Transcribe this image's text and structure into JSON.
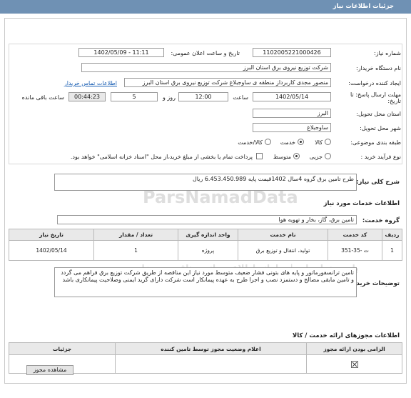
{
  "header": {
    "title": "جزئیات اطلاعات نیاز"
  },
  "form": {
    "need_number_label": "شماره نیاز:",
    "need_number": "1102005221000426",
    "announce_label": "تاریخ و ساعت اعلان عمومی:",
    "announce_value": "1402/05/09 - 11:11",
    "buyer_label": "نام دستگاه خریدار:",
    "buyer_value": "شرکت توزیع نیروی برق استان البرز",
    "creator_label": "ایجاد کننده درخواست:",
    "creator_value": "منصور مجدی کاربرداز منطقه ی ساوجبلاغ شرکت توزیع نیروی برق استان البرز",
    "contact_link": "اطلاعات تماس خریدار",
    "deadline_label": "مهلت ارسال پاسخ: تا تاریخ:",
    "deadline_date": "1402/05/14",
    "hour_label": "ساعت",
    "deadline_hour": "12:00",
    "days_value": "5",
    "days_label": "روز و",
    "remaining_time": "00:44:23",
    "remaining_label": "ساعت باقی مانده",
    "province_label": "استان محل تحویل:",
    "province_value": "البرز",
    "city_label": "شهر محل تحویل:",
    "city_value": "ساوجبلاغ",
    "category_label": "طبقه بندی موضوعی:",
    "category_options": [
      "کالا",
      "خدمت",
      "کالا/خدمت"
    ],
    "category_selected": "خدمت",
    "process_label": "نوع فرآیند خرید :",
    "process_options": [
      "جزیی",
      "متوسط"
    ],
    "process_selected": "متوسط",
    "payment_note": "پرداخت تمام یا بخشی از مبلغ خرید،از محل \"اسناد خزانه اسلامی\" خواهد بود."
  },
  "description": {
    "label": "شرح کلی نیاز:",
    "value": "طرح تامین برق گروه 4سال 1402قیمت پایه 6.453.450.989 ریال"
  },
  "services": {
    "section_title": "اطلاعات خدمات مورد نیاز",
    "group_label": "گروه خدمت:",
    "group_value": "تامین برق، گاز، بخار و تهویه هوا",
    "columns": [
      "ردیف",
      "کد خدمت",
      "نام خدمت",
      "واحد اندازه گیری",
      "تعداد / مقدار",
      "تاریخ نیاز"
    ],
    "rows": [
      {
        "index": "1",
        "code": "ت -35-351",
        "name": "تولید، انتقال و توزیع برق",
        "unit": "پروژه",
        "qty": "1",
        "date": "1402/05/14"
      }
    ]
  },
  "buyer_notes": {
    "label": "توضیحات خریدار:",
    "value": "تامین ترانسفورماتور و پایه های بتونی فشار ضعیف متوسط مورد نیاز این مناقصه از طریق شرکت توزیع برق فراهم می گردد و تامین مابقی مصالح و دستمزد نصب و اجرا طرح به عهده پیمانکار است شرکت دارای گرید ایمنی وصلاحیت پیمانکاری باشد"
  },
  "supplier_docs": {
    "section_title": "اطلاعات مجوزهای ارائه خدمت / کالا",
    "columns": [
      "الزامی بودن ارائه مجوز",
      "اعلام وضعیت مجوز توسط تامین کننده",
      "جزئیات"
    ],
    "view_button": "مشاهده مجوز"
  },
  "watermark": {
    "line1": "ParsNamadData",
    "line2": "پارس نماد داده | سامانه اطلاع رسانی مناقصه و مزایده"
  }
}
